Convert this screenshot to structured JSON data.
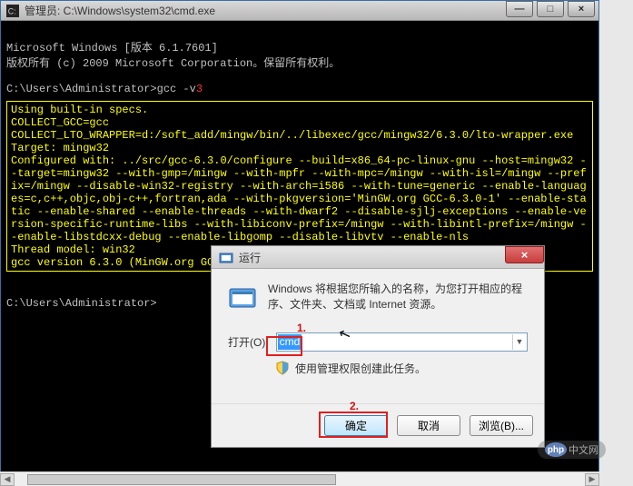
{
  "cmd": {
    "title": "管理员: C:\\Windows\\system32\\cmd.exe",
    "line1": "Microsoft Windows [版本 6.1.7601]",
    "line2": "版权所有 (c) 2009 Microsoft Corporation。保留所有权利。",
    "prompt1_pre": "C:\\Users\\Administrator>gcc -v",
    "prompt1_suf": "3",
    "yellow": "Using built-in specs.\nCOLLECT_GCC=gcc\nCOLLECT_LTO_WRAPPER=d:/soft_add/mingw/bin/../libexec/gcc/mingw32/6.3.0/lto-wrapper.exe\nTarget: mingw32\nConfigured with: ../src/gcc-6.3.0/configure --build=x86_64-pc-linux-gnu --host=mingw32 --target=mingw32 --with-gmp=/mingw --with-mpfr --with-mpc=/mingw --with-isl=/mingw --prefix=/mingw --disable-win32-registry --with-arch=i586 --with-tune=generic --enable-languages=c,c++,objc,obj-c++,fortran,ada --with-pkgversion='MinGW.org GCC-6.3.0-1' --enable-static --enable-shared --enable-threads --with-dwarf2 --disable-sjlj-exceptions --enable-version-specific-runtime-libs --with-libiconv-prefix=/mingw --with-libintl-prefix=/mingw --enable-libstdcxx-debug --enable-libgomp --disable-libvtv --enable-nls\nThread model: win32\ngcc version 6.3.0 (MinGW.org GCC-6.3.0-1)",
    "prompt2": "C:\\Users\\Administrator>"
  },
  "run": {
    "title": "运行",
    "description": "Windows 将根据您所输入的名称，为您打开相应的程序、文件夹、文档或 Internet 资源。",
    "open_label": "打开(O):",
    "input_value": "cmd",
    "admin_text": "使用管理权限创建此任务。",
    "ok": "确定",
    "cancel": "取消",
    "browse": "浏览(B)..."
  },
  "annotations": {
    "step1": "1.",
    "step2": "2."
  },
  "watermark": {
    "logo": "php",
    "text": "中文网"
  },
  "controls": {
    "min": "—",
    "max": "□",
    "close": "×"
  }
}
